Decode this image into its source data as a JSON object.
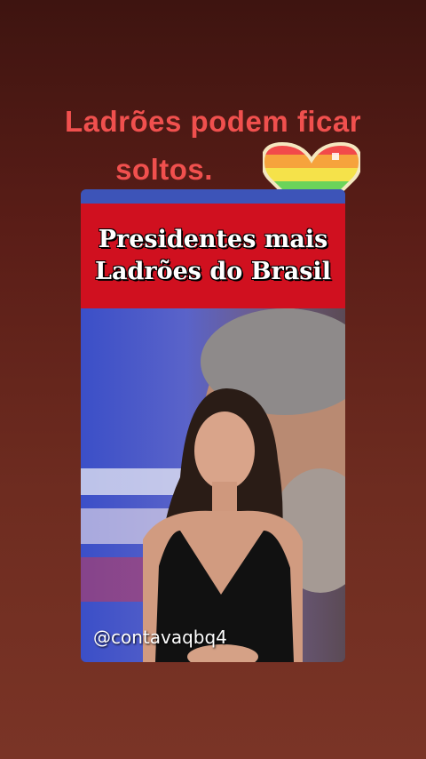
{
  "caption": {
    "line1": "Ladrões podem ficar",
    "line2": "soltos."
  },
  "video": {
    "banner_line1": "Presidentes mais",
    "banner_line2": "Ladrões do Brasil",
    "watermark": "@contavaqbq4"
  },
  "icons": {
    "heart": "rainbow-heart-icon"
  },
  "colors": {
    "caption": "#f0504e",
    "banner": "#d0101f",
    "background_top": "#3e1410",
    "background_bottom": "#7a3426"
  }
}
